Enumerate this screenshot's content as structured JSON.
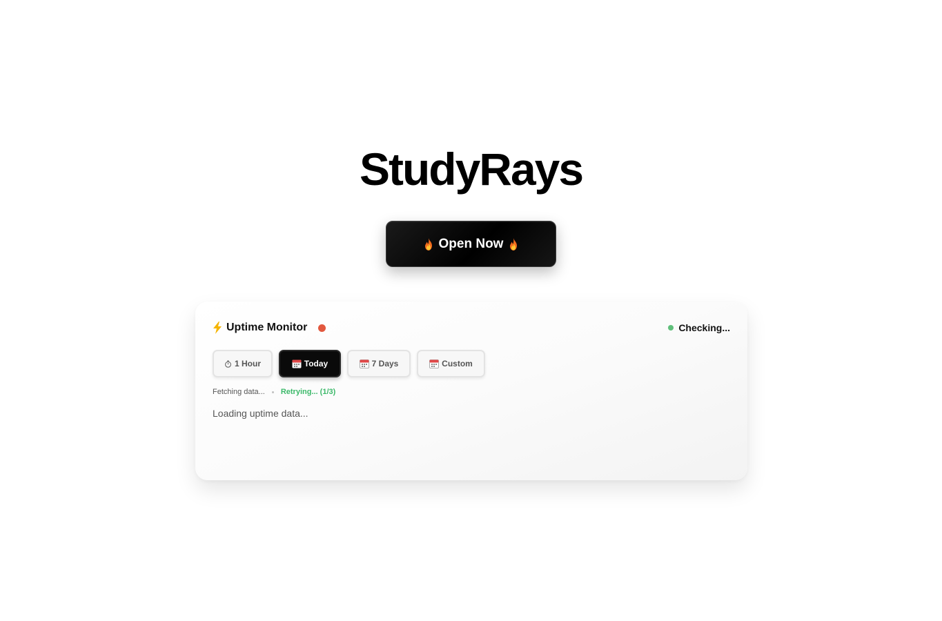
{
  "brand": {
    "title": "StudyRays"
  },
  "cta": {
    "label": "Open Now",
    "icon": "fire-icon",
    "colors": {
      "background": "#000000",
      "text": "#ffffff"
    }
  },
  "monitor": {
    "title": "Uptime Monitor",
    "title_icon": "lightning-bolt-icon",
    "live_indicator_color": "#e2583e",
    "status": {
      "label": "Checking...",
      "dot_color": "#5fbf7a"
    },
    "ranges": [
      {
        "label": "1 Hour",
        "icon": "stopwatch-icon",
        "active": false
      },
      {
        "label": "Today",
        "icon": "calendar-icon",
        "active": true
      },
      {
        "label": "7 Days",
        "icon": "calendar-icon",
        "active": false
      },
      {
        "label": "Custom",
        "icon": "calendar-icon",
        "active": false
      }
    ],
    "fetch_status": "Fetching data...",
    "retry_status": "Retrying... (1/3)",
    "retry_color": "#3cb96a",
    "loading_message": "Loading uptime data..."
  }
}
